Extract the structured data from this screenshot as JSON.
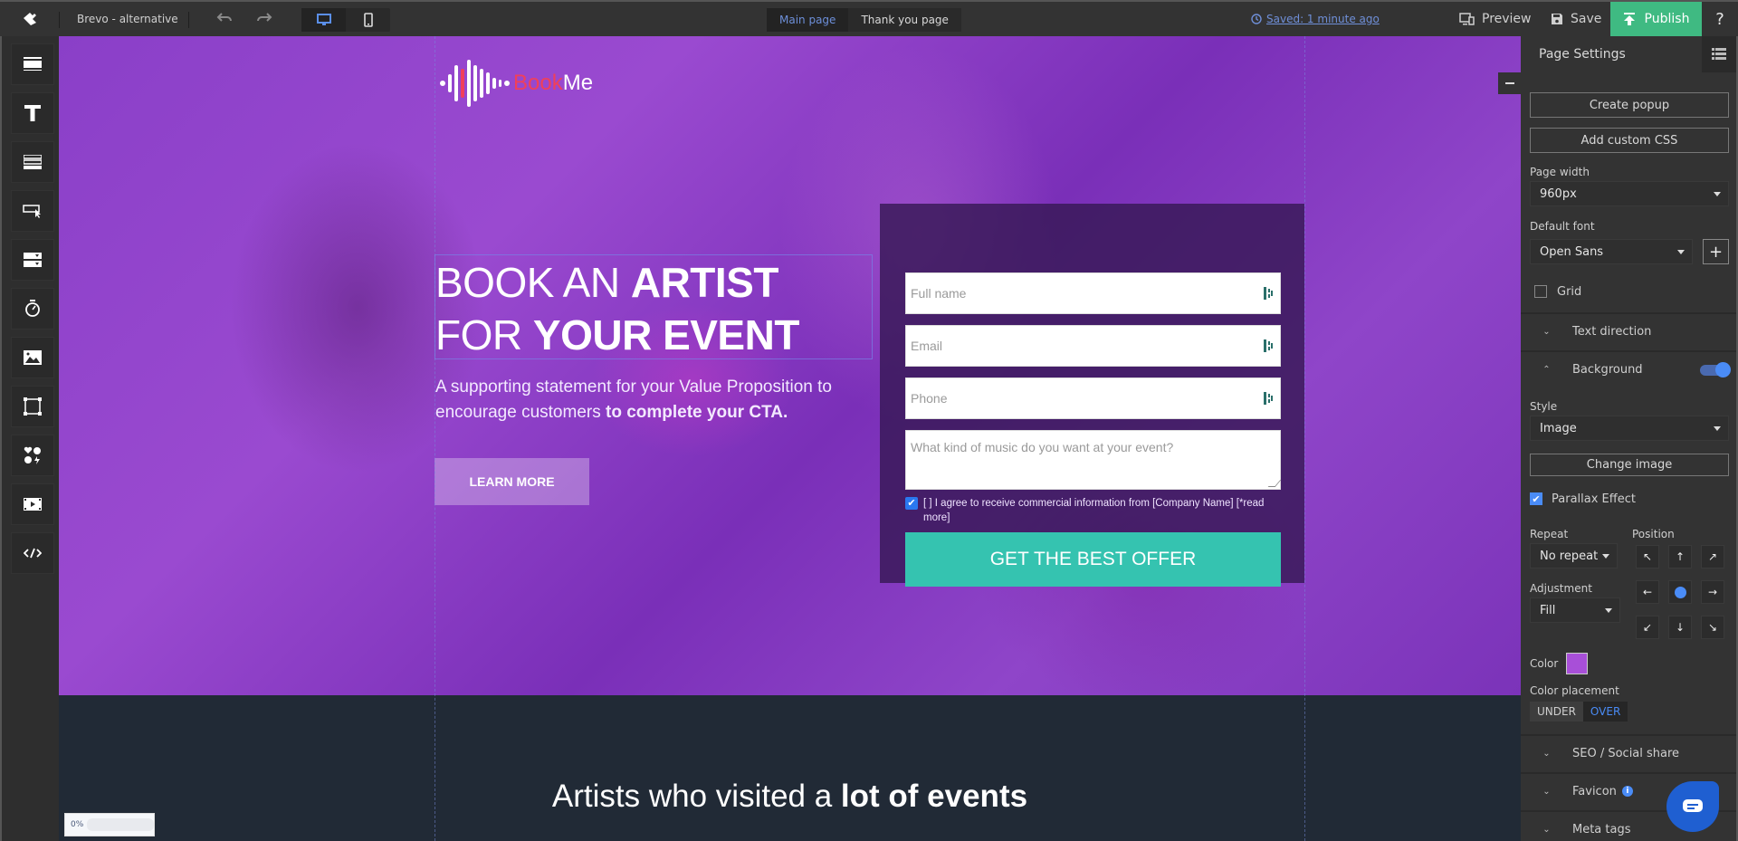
{
  "topbar": {
    "app_title": "Brevo - alternative",
    "undo_icon": "undo-icon",
    "redo_icon": "redo-icon",
    "devices": [
      {
        "name": "desktop",
        "icon": "desktop-icon",
        "active": true
      },
      {
        "name": "mobile",
        "icon": "mobile-icon",
        "active": false
      }
    ],
    "page_tabs": [
      {
        "label": "Main page",
        "active": true
      },
      {
        "label": "Thank you page",
        "active": false
      }
    ],
    "saved_status": "Saved: 1 minute ago",
    "preview_label": "Preview",
    "save_label": "Save",
    "publish_label": "Publish",
    "help_label": "?"
  },
  "left_tools": [
    {
      "name": "section-tool",
      "icon": "section-icon"
    },
    {
      "name": "text-tool",
      "icon": "text-icon"
    },
    {
      "name": "form-tool",
      "icon": "form-icon"
    },
    {
      "name": "button-tool",
      "icon": "button-cursor-icon"
    },
    {
      "name": "dropdown-tool",
      "icon": "dropdown-icon"
    },
    {
      "name": "timer-tool",
      "icon": "timer-icon"
    },
    {
      "name": "image-tool",
      "icon": "image-icon"
    },
    {
      "name": "shape-tool",
      "icon": "shape-icon"
    },
    {
      "name": "icons-tool",
      "icon": "emoji-icon"
    },
    {
      "name": "video-tool",
      "icon": "video-icon"
    },
    {
      "name": "code-tool",
      "icon": "code-icon"
    }
  ],
  "canvas": {
    "brand": {
      "part1": "Book",
      "part2": "Me"
    },
    "headline": {
      "line1_light": "BOOK AN ",
      "line1_bold": "ARTIST",
      "line2_light": "FOR ",
      "line2_bold": "YOUR EVENT"
    },
    "subtext": {
      "normal1": "A supporting statement for your Value Proposition to encourage customers ",
      "bold": "to complete your CTA."
    },
    "learn_more_label": "LEARN MORE",
    "form": {
      "fields": [
        {
          "placeholder": "Full name"
        },
        {
          "placeholder": "Email"
        },
        {
          "placeholder": "Phone"
        }
      ],
      "textarea_placeholder": "What kind of music do you want at your event?",
      "consent_checked": true,
      "consent_text": "[ ] I agree to receive commercial information from [Company Name] [*read more]",
      "cta_label": "GET THE BEST OFFER"
    },
    "section2_title": {
      "light": "Artists who visited a ",
      "bold": "lot of events"
    },
    "progress": {
      "label": "0%",
      "value": 0
    }
  },
  "right_panel": {
    "title": "Page Settings",
    "create_popup_label": "Create popup",
    "add_css_label": "Add custom CSS",
    "page_width_label": "Page width",
    "page_width_value": "960px",
    "default_font_label": "Default font",
    "default_font_value": "Open Sans",
    "grid_label": "Grid",
    "grid_checked": false,
    "text_direction_label": "Text direction",
    "background_label": "Background",
    "background_enabled": true,
    "style_label": "Style",
    "style_value": "Image",
    "change_image_label": "Change image",
    "parallax_label": "Parallax Effect",
    "parallax_checked": true,
    "repeat_label": "Repeat",
    "repeat_value": "No repeat",
    "position_label": "Position",
    "position_selected": "center",
    "adjustment_label": "Adjustment",
    "adjustment_value": "Fill",
    "color_label": "Color",
    "color_value": "#a84fd8",
    "color_placement_label": "Color placement",
    "color_placement_options": [
      "UNDER",
      "OVER"
    ],
    "color_placement_selected": "OVER",
    "seo_label": "SEO / Social share",
    "favicon_label": "Favicon",
    "meta_tags_label": "Meta tags"
  },
  "colors": {
    "publish": "#3fba82",
    "accent_blue": "#4a8cf7",
    "cta_teal": "#35c3b0",
    "brand_red": "#f0405a"
  }
}
